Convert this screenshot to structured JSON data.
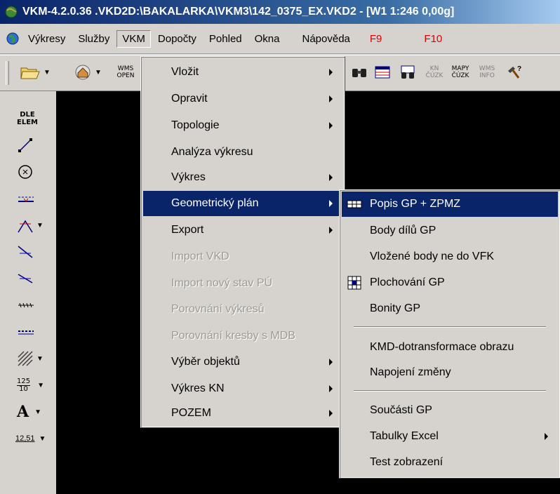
{
  "window": {
    "title": "VKM-4.2.0.36 .VKD2D:\\BAKALARKA\\VKM3\\142_0375_EX.VKD2 - [W1 1:246 0,00g]"
  },
  "menubar": {
    "items": [
      "Výkresy",
      "Služby",
      "VKM",
      "Dopočty",
      "Pohled",
      "Okna",
      "Nápověda"
    ],
    "fkeys": [
      "F9",
      "F10"
    ]
  },
  "toolbar": {
    "wms_open": [
      "WMS",
      "OPEN"
    ],
    "kn_cuzk": [
      "KN",
      "ČÚZK"
    ],
    "mapy_cuzk": [
      "MAPY",
      "ČÚZK"
    ],
    "wms_info": [
      "WMS",
      "INFO"
    ]
  },
  "lefttoolbar": {
    "dle_elem": [
      "DLE",
      "ELEM"
    ],
    "fraction": [
      "125",
      "10"
    ],
    "text_tool": "A",
    "number_tool": "12,51"
  },
  "vkm_menu": {
    "items": [
      {
        "label": "Vložit",
        "submenu": true,
        "disabled": false
      },
      {
        "label": "Opravit",
        "submenu": true,
        "disabled": false
      },
      {
        "label": "Topologie",
        "submenu": true,
        "disabled": false
      },
      {
        "label": "Analýza výkresu",
        "submenu": false,
        "disabled": false
      },
      {
        "label": "Výkres",
        "submenu": true,
        "disabled": false
      },
      {
        "label": "Geometrický plán",
        "submenu": true,
        "disabled": false,
        "highlighted": true
      },
      {
        "label": "Export",
        "submenu": true,
        "disabled": false
      },
      {
        "label": "Import VKD",
        "submenu": false,
        "disabled": true
      },
      {
        "label": "Import nový stav PÚ",
        "submenu": false,
        "disabled": true
      },
      {
        "label": "Porovnání výkresů",
        "submenu": false,
        "disabled": true
      },
      {
        "label": "Porovnání kresby s MDB",
        "submenu": false,
        "disabled": true
      },
      {
        "label": "Výběr objektů",
        "submenu": true,
        "disabled": false
      },
      {
        "label": "Výkres KN",
        "submenu": true,
        "disabled": false
      },
      {
        "label": "POZEM",
        "submenu": true,
        "disabled": false
      }
    ]
  },
  "gp_submenu": {
    "items": [
      {
        "label": "Popis GP + ZPMZ",
        "highlighted": true,
        "icon": "table-icon"
      },
      {
        "label": "Body dílů GP"
      },
      {
        "label": "Vložené body ne do VFK"
      },
      {
        "label": "Plochování GP",
        "icon": "grid-icon"
      },
      {
        "label": "Bonity GP"
      },
      {
        "label": "KMD-dotransformace obrazu"
      },
      {
        "label": "Napojení změny"
      },
      {
        "label": "Součásti GP"
      },
      {
        "label": "Tabulky Excel",
        "submenu": true
      },
      {
        "label": "Test zobrazení"
      }
    ]
  },
  "colors": {
    "highlight": "#0a246a",
    "face": "#d6d3ce",
    "canvas": "#000000",
    "fkey": "#e00000"
  }
}
